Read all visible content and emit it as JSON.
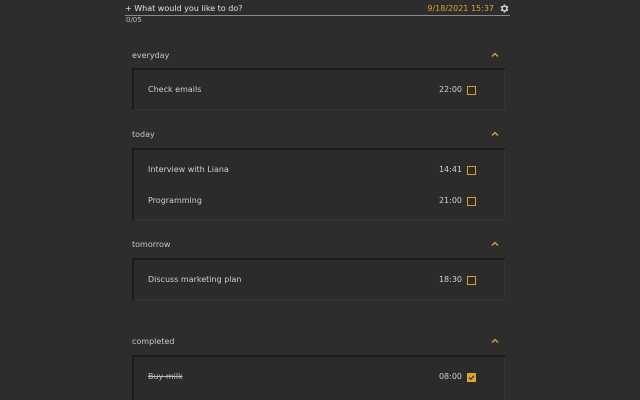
{
  "header": {
    "new_task_placeholder": "+ What would you like to do?",
    "datetime": "9/18/2021 15:37",
    "counter": "0/05"
  },
  "colors": {
    "accent": "#e0a52a",
    "background": "#2d2d2d"
  },
  "sections": [
    {
      "title": "everyday",
      "tasks": [
        {
          "label": "Check emails",
          "time": "22:00",
          "done": false
        }
      ]
    },
    {
      "title": "today",
      "tasks": [
        {
          "label": "Interview with Liana",
          "time": "14:41",
          "done": false
        },
        {
          "label": "Programming",
          "time": "21:00",
          "done": false
        }
      ]
    },
    {
      "title": "tomorrow",
      "tasks": [
        {
          "label": "Discuss marketing plan",
          "time": "18:30",
          "done": false
        }
      ]
    },
    {
      "title": "completed",
      "tasks": [
        {
          "label": "Buy milk",
          "time": "08:00",
          "done": true
        }
      ]
    }
  ],
  "icons": {
    "settings": "gear-icon",
    "collapse": "chevron-up-icon",
    "check": "checkmark-icon"
  }
}
